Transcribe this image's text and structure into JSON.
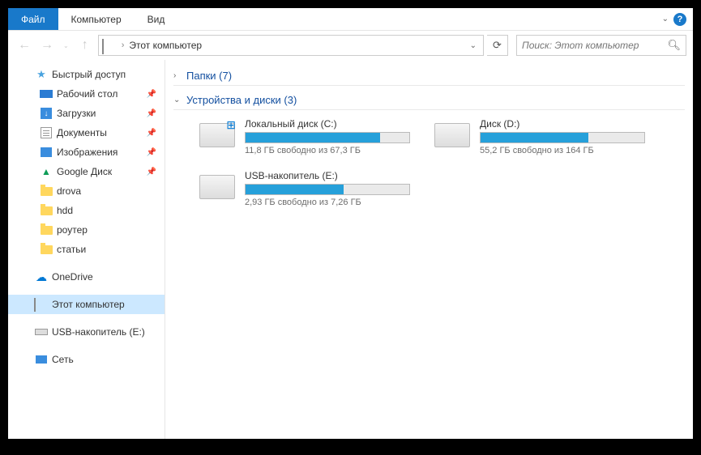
{
  "ribbon": {
    "tabs": [
      "Файл",
      "Компьютер",
      "Вид"
    ]
  },
  "navbar": {
    "address": "Этот компьютер",
    "address_caret": "›",
    "search_placeholder": "Поиск: Этот компьютер"
  },
  "sidebar": {
    "quick_access": "Быстрый доступ",
    "items": [
      {
        "label": "Рабочий стол",
        "pinned": true
      },
      {
        "label": "Загрузки",
        "pinned": true
      },
      {
        "label": "Документы",
        "pinned": true
      },
      {
        "label": "Изображения",
        "pinned": true
      },
      {
        "label": "Google Диск",
        "pinned": true
      },
      {
        "label": "drova",
        "pinned": false
      },
      {
        "label": "hdd",
        "pinned": false
      },
      {
        "label": "роутер",
        "pinned": false
      },
      {
        "label": "статьи",
        "pinned": false
      }
    ],
    "onedrive": "OneDrive",
    "this_pc": "Этот компьютер",
    "usb": "USB-накопитель (E:)",
    "network": "Сеть"
  },
  "content": {
    "folders_header": "Папки (7)",
    "drives_header": "Устройства и диски (3)",
    "drives": [
      {
        "name": "Локальный диск (C:)",
        "stats": "11,8 ГБ свободно из 67,3 ГБ",
        "fill_pct": 82,
        "windows": true
      },
      {
        "name": "Диск (D:)",
        "stats": "55,2 ГБ свободно из 164 ГБ",
        "fill_pct": 66,
        "windows": false
      },
      {
        "name": "USB-накопитель (E:)",
        "stats": "2,93 ГБ свободно из 7,26 ГБ",
        "fill_pct": 60,
        "windows": false
      }
    ]
  }
}
